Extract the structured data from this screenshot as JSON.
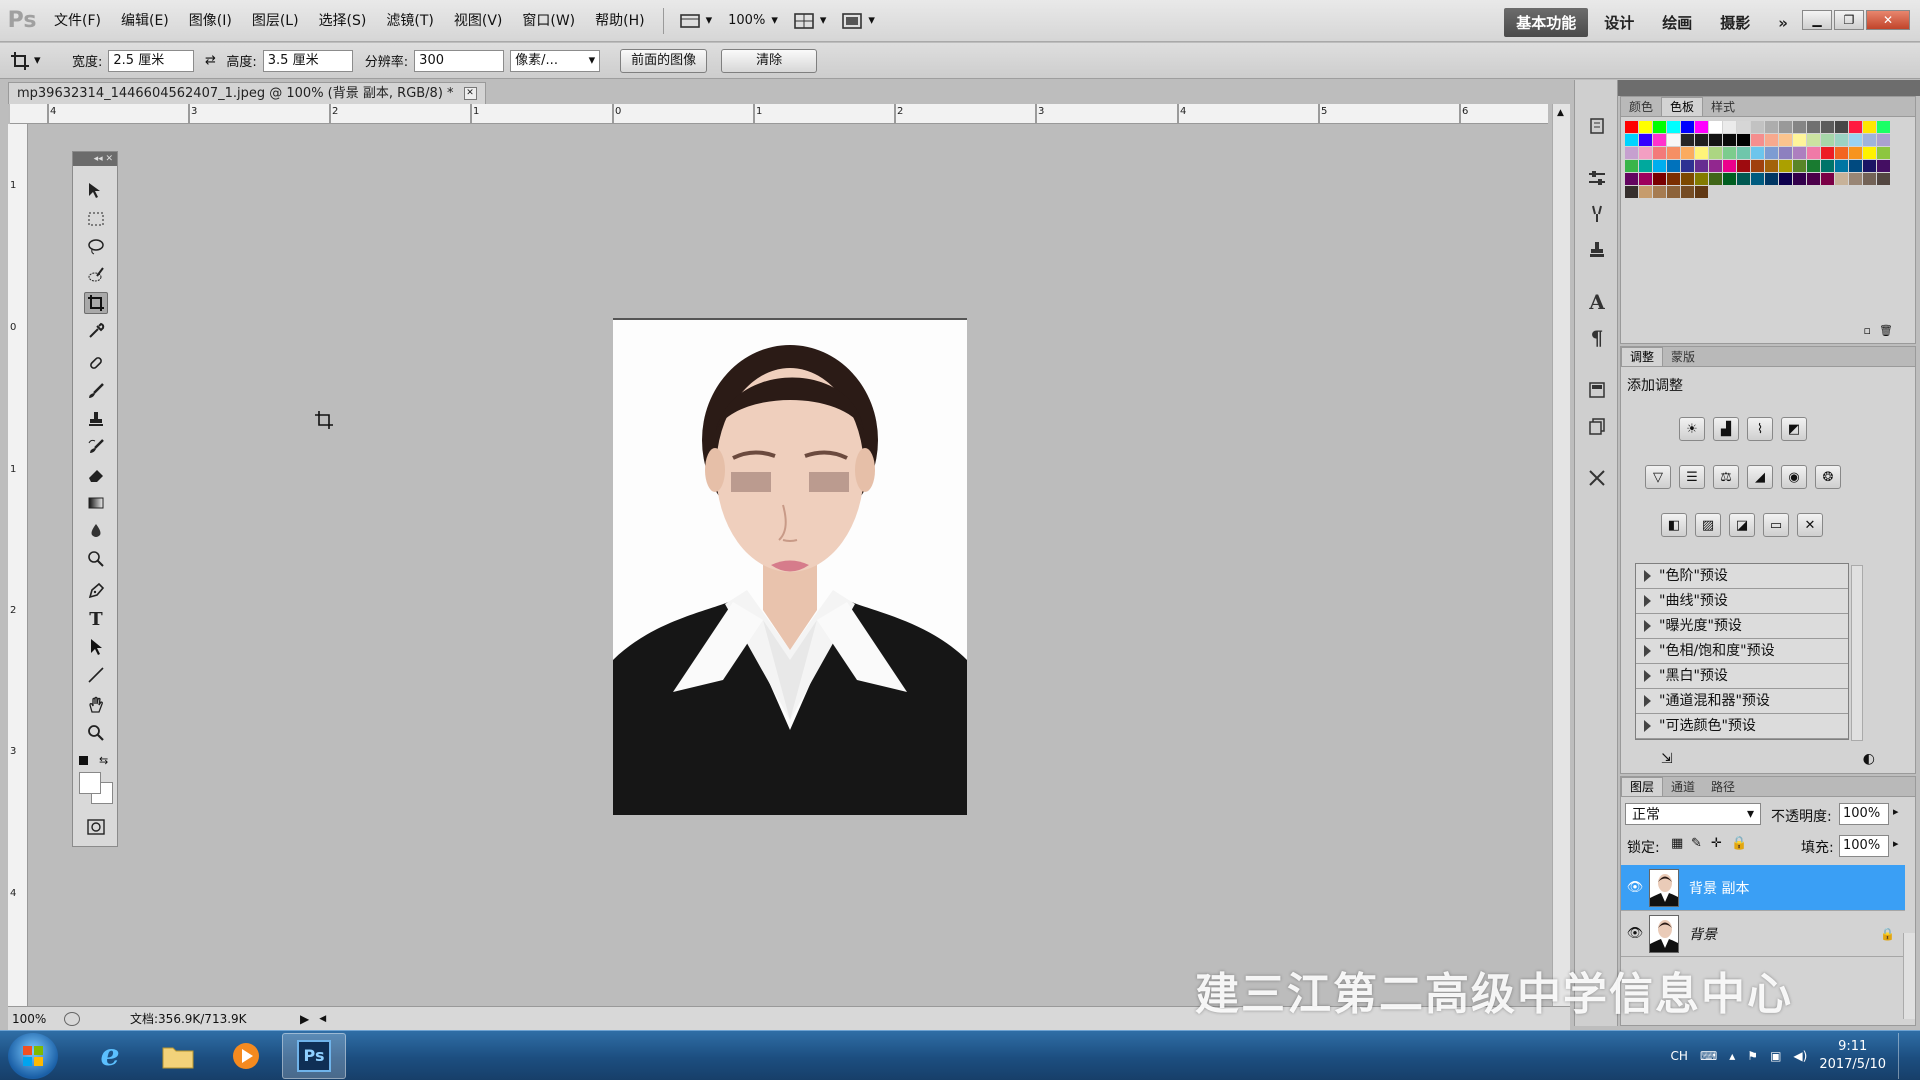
{
  "menubar": {
    "logo": "Ps",
    "menus": [
      "文件(F)",
      "编辑(E)",
      "图像(I)",
      "图层(L)",
      "选择(S)",
      "滤镜(T)",
      "视图(V)",
      "窗口(W)",
      "帮助(H)"
    ],
    "zoom": "100%",
    "workspaces": [
      "基本功能",
      "设计",
      "绘画",
      "摄影"
    ],
    "more": "»"
  },
  "options": {
    "width_label": "宽度:",
    "width_value": "2.5 厘米",
    "height_label": "高度:",
    "height_value": "3.5 厘米",
    "resolution_label": "分辨率:",
    "resolution_value": "300",
    "unit_value": "像素/...",
    "front_image_button": "前面的图像",
    "clear_button": "清除"
  },
  "document": {
    "tab_title": "mp39632314_1446604562407_1.jpeg @ 100% (背景 副本, RGB/8) *",
    "h_ruler": [
      "4",
      "3",
      "2",
      "1",
      "0",
      "1",
      "2",
      "3",
      "4",
      "5",
      "6"
    ],
    "v_ruler": [
      "1",
      "0",
      "1",
      "2",
      "3",
      "4"
    ]
  },
  "status": {
    "zoom": "100%",
    "doc_info": "文档:356.9K/713.9K"
  },
  "swatches": {
    "tabs": [
      "颜色",
      "色板",
      "样式"
    ],
    "active_tab": "色板",
    "colors": [
      "#ff0000",
      "#ffff00",
      "#00ff00",
      "#00ffff",
      "#0000ff",
      "#ff00ff",
      "#ffffff",
      "#ebebeb",
      "#d6d6d6",
      "#c2c2c2",
      "#adadad",
      "#999999",
      "#858585",
      "#707070",
      "#5c5c5c",
      "#474747",
      "#ff1a40",
      "#ffe600",
      "#1aff66",
      "#00d4ff",
      "#3300ff",
      "#ff33cc",
      "#f7f7f7",
      "#262626",
      "#1f1f1f",
      "#141414",
      "#0a0a0a",
      "#000000",
      "#f58e8e",
      "#f7a98e",
      "#fbc48e",
      "#fff59a",
      "#cce3a1",
      "#a6d6a9",
      "#9bd2c3",
      "#9ad3ef",
      "#9fb3dc",
      "#aaa1d0",
      "#c6a0cf",
      "#f39fc2",
      "#f37a7a",
      "#f58f64",
      "#fbab5f",
      "#fff47a",
      "#acd682",
      "#7ccc8d",
      "#6fc6ab",
      "#6cc5ec",
      "#7d9cd2",
      "#8d80bf",
      "#ad7fbf",
      "#f07aa7",
      "#ed1c24",
      "#f26522",
      "#f7941d",
      "#fff200",
      "#8dc63f",
      "#39b54a",
      "#00a99d",
      "#00aeef",
      "#0072bc",
      "#2e3192",
      "#662d91",
      "#92278f",
      "#ec008c",
      "#9e0b0f",
      "#a0410d",
      "#a3620a",
      "#aba000",
      "#598527",
      "#197b30",
      "#007469",
      "#0076a3",
      "#004a80",
      "#1b1464",
      "#440e62",
      "#630460",
      "#9e005d",
      "#790000",
      "#7b2e00",
      "#7d4900",
      "#827b00",
      "#406618",
      "#005e20",
      "#005952",
      "#005b7f",
      "#003663",
      "#0d004c",
      "#32004b",
      "#4b0049",
      "#7b0046",
      "#c7b299",
      "#998675",
      "#736357",
      "#534741",
      "#362f2d",
      "#c69c6d",
      "#a67c52",
      "#8c6239",
      "#754c24",
      "#603813"
    ]
  },
  "adjustments": {
    "tabs": [
      "调整",
      "蒙版"
    ],
    "title": "添加调整",
    "presets": [
      "\"色阶\"预设",
      "\"曲线\"预设",
      "\"曝光度\"预设",
      "\"色相/饱和度\"预设",
      "\"黑白\"预设",
      "\"通道混和器\"预设",
      "\"可选颜色\"预设"
    ]
  },
  "layers": {
    "tabs": [
      "图层",
      "通道",
      "路径"
    ],
    "blend_mode": "正常",
    "opacity_label": "不透明度:",
    "opacity_value": "100%",
    "lock_label": "锁定:",
    "fill_label": "填充:",
    "fill_value": "100%",
    "items": [
      {
        "name": "背景 副本"
      },
      {
        "name": "背景"
      }
    ]
  },
  "watermark": "建三江第二高级中学信息中心",
  "taskbar": {
    "tray_lang": "CH",
    "time": "9:11",
    "date": "2017/5/10",
    "ps_label": "Ps"
  }
}
